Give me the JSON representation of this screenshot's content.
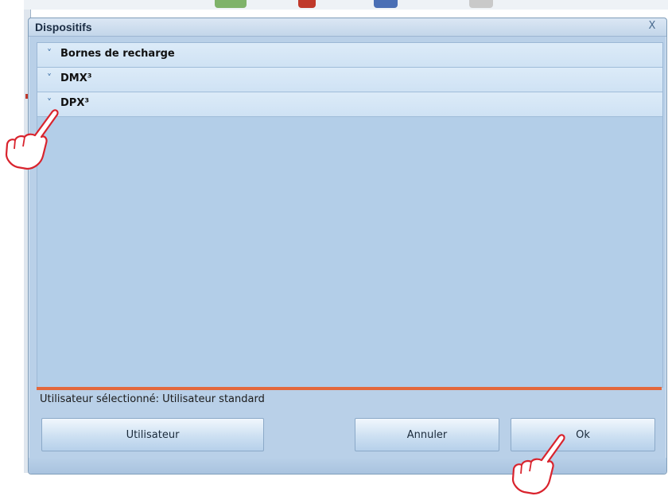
{
  "dialog": {
    "title": "Dispositifs",
    "close_label": "X"
  },
  "groups": [
    {
      "label": "Bornes de recharge",
      "chevron": "˅"
    },
    {
      "label": "DMX³",
      "chevron": "˅"
    },
    {
      "label": "DPX³",
      "chevron": "˅"
    }
  ],
  "status": {
    "text": "Utilisateur sélectionné: Utilisateur standard"
  },
  "buttons": {
    "user_label": "Utilisateur",
    "cancel_label": "Annuler",
    "ok_label": "Ok"
  },
  "colors": {
    "accent_bar": "#e3683c",
    "panel": "#b3cee8",
    "annotation": "#d9232d"
  },
  "icons": {
    "pointer": "hand-pointer-icon"
  }
}
